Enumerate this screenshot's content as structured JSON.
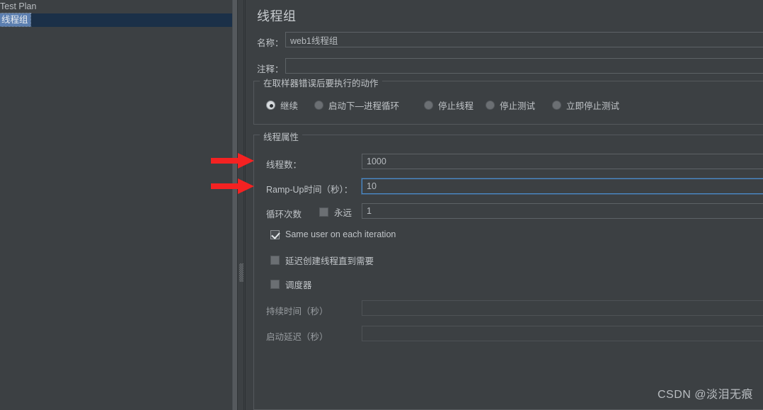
{
  "colors": {
    "background": "#3c4043",
    "panel_border": "#55595d",
    "text": "#c0c4c8",
    "focus_accent": "#4a8ccd",
    "tree_selection_label": "#5c7fb0",
    "tree_selection_row": "#1b3048",
    "annotation_arrow": "#f42222"
  },
  "tree": {
    "items": [
      {
        "label": "Test Plan",
        "selected": false
      },
      {
        "label": "线程组",
        "selected": true
      }
    ]
  },
  "panel": {
    "title": "线程组",
    "fields": {
      "name_label": "名称：",
      "name_value": "web1线程组",
      "comment_label": "注释：",
      "comment_value": ""
    },
    "error_action_group": {
      "title": "在取样器错误后要执行的动作",
      "options": [
        {
          "label": "继续",
          "selected": true
        },
        {
          "label": "启动下—进程循环",
          "selected": false
        },
        {
          "label": "停止线程",
          "selected": false
        },
        {
          "label": "停止测试",
          "selected": false
        },
        {
          "label": "立即停止测试",
          "selected": false
        }
      ]
    },
    "thread_properties_group": {
      "title": "线程属性",
      "thread_count_label": "线程数：",
      "thread_count_value": "1000",
      "ramp_up_label": "Ramp-Up时间（秒）：",
      "ramp_up_value": "10",
      "ramp_up_focused": true,
      "loop_count_label": "循环次数",
      "forever_label": "永远",
      "forever_checked": false,
      "loop_count_value": "1",
      "same_user_label": "Same user on each iteration",
      "same_user_checked": true,
      "delayed_start_label": "延迟创建线程直到需要",
      "delayed_start_checked": false,
      "scheduler_label": "调度器",
      "scheduler_checked": false,
      "duration_label": "持续时间（秒）",
      "duration_value": "",
      "startup_delay_label": "启动延迟（秒）",
      "startup_delay_value": ""
    }
  },
  "annotations": {
    "arrow_thread_count": "arrow-right-icon",
    "arrow_ramp_up": "arrow-right-icon"
  },
  "watermark": {
    "text": "CSDN @淡泪无痕"
  }
}
